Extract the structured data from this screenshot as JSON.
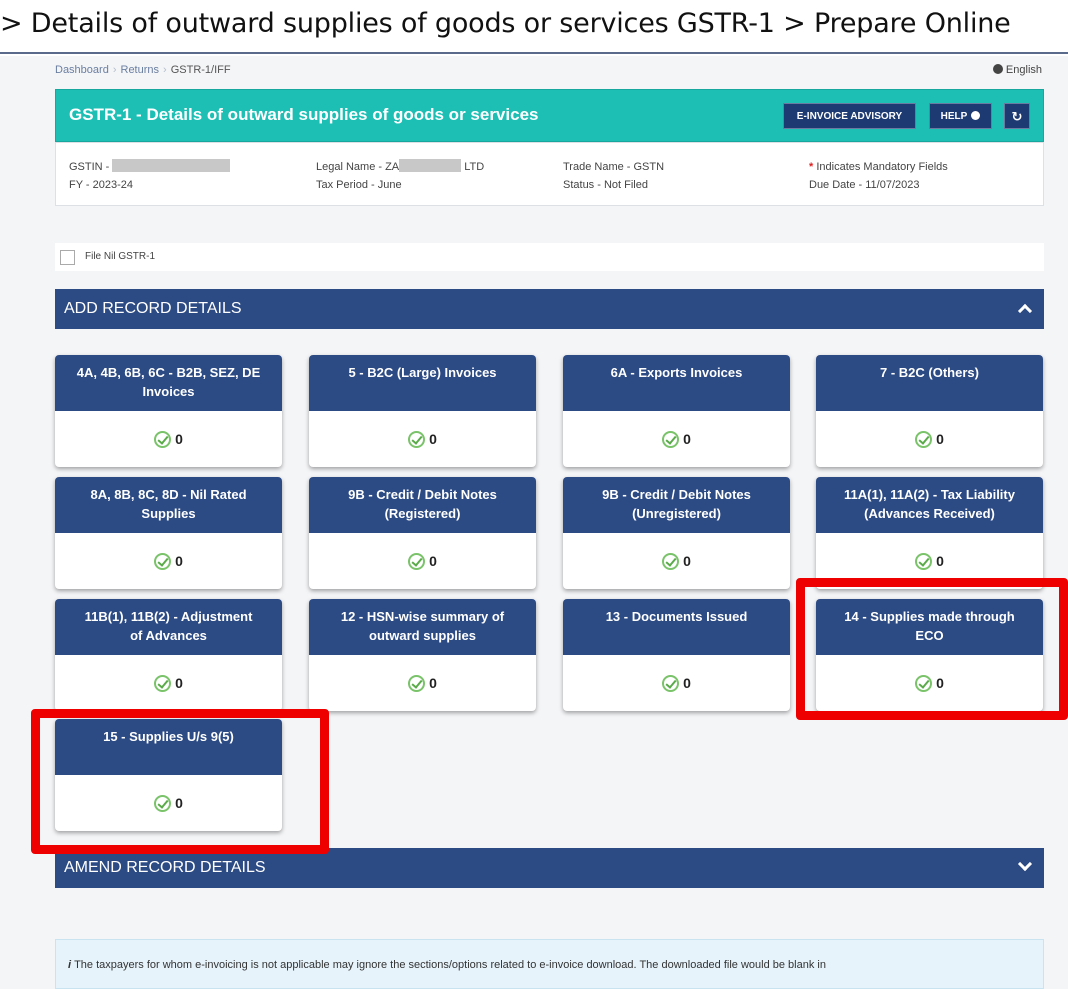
{
  "caption": "> Details of outward supplies of goods or services GSTR-1 > Prepare Online",
  "breadcrumb": {
    "items": [
      "Dashboard",
      "Returns"
    ],
    "current": "GSTR-1/IFF"
  },
  "language": "English",
  "header": {
    "title": "GSTR-1 - Details of outward supplies of goods or services",
    "advisory_label": "E-INVOICE ADVISORY",
    "help_label": "HELP",
    "refresh_icon": "refresh-icon"
  },
  "info": {
    "gstin_label": "GSTIN -",
    "fy": "FY - 2023-24",
    "legal_name_label": "Legal Name - ZA",
    "legal_name_suffix": "LTD",
    "tax_period": "Tax Period - June",
    "trade_name": "Trade Name - GSTN",
    "status": "Status - Not Filed",
    "mandatory_note": "Indicates Mandatory Fields",
    "due_date": "Due Date - 11/07/2023"
  },
  "nil_return": {
    "label": "File Nil GSTR-1"
  },
  "add_section": {
    "title": "ADD RECORD DETAILS"
  },
  "tiles": [
    {
      "line1": "4A, 4B, 6B, 6C - B2B, SEZ, DE",
      "line2": "Invoices",
      "count": "0"
    },
    {
      "line1": "5 - B2C (Large) Invoices",
      "line2": "",
      "count": "0"
    },
    {
      "line1": "6A - Exports Invoices",
      "line2": "",
      "count": "0"
    },
    {
      "line1": "7 - B2C (Others)",
      "line2": "",
      "count": "0"
    },
    {
      "line1": "8A, 8B, 8C, 8D - Nil Rated",
      "line2": "Supplies",
      "count": "0"
    },
    {
      "line1": "9B - Credit / Debit Notes",
      "line2": "(Registered)",
      "count": "0"
    },
    {
      "line1": "9B - Credit / Debit Notes",
      "line2": "(Unregistered)",
      "count": "0"
    },
    {
      "line1": "11A(1), 11A(2) - Tax Liability",
      "line2": "(Advances Received)",
      "count": "0"
    },
    {
      "line1": "11B(1), 11B(2) - Adjustment",
      "line2": "of Advances",
      "count": "0"
    },
    {
      "line1": "12 - HSN-wise summary of",
      "line2": "outward supplies",
      "count": "0"
    },
    {
      "line1": "13 - Documents Issued",
      "line2": "",
      "count": "0"
    },
    {
      "line1": "14 - Supplies made through",
      "line2": "ECO",
      "count": "0"
    },
    {
      "line1": "15 - Supplies U/s 9(5)",
      "line2": "",
      "count": "0"
    }
  ],
  "amend_section": {
    "title": "AMEND RECORD DETAILS"
  },
  "notice": "The taxpayers for whom e-invoicing is not applicable may ignore the sections/options related to e-invoice download. The downloaded file would be blank in",
  "colors": {
    "teal": "#1dbfb5",
    "navy": "#2c4a83",
    "highlight": "#ee0000",
    "check": "#7ac36a"
  }
}
